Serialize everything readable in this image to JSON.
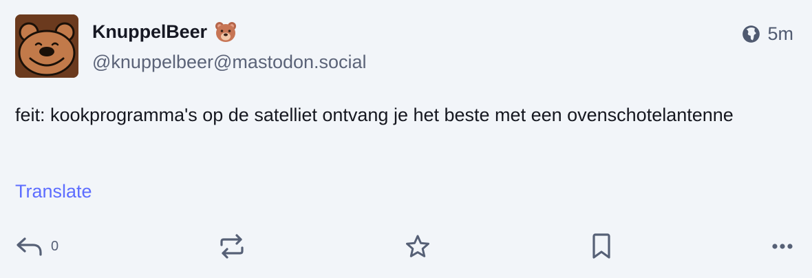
{
  "author": {
    "display_name": "KnuppelBeer",
    "emoji": "bear-face-emoji",
    "handle": "@knuppelbeer@mastodon.social",
    "avatar": "bear-avatar"
  },
  "meta": {
    "visibility_icon": "globe-icon",
    "time": "5m"
  },
  "content": {
    "text": "feit: kookprogramma's op de satelliet ontvang je het beste met een ovenschotelantenne"
  },
  "translate_label": "Translate",
  "actions": {
    "reply": {
      "icon": "reply-icon",
      "count": "0"
    },
    "boost": {
      "icon": "boost-icon"
    },
    "favourite": {
      "icon": "star-icon"
    },
    "bookmark": {
      "icon": "bookmark-icon"
    },
    "more": {
      "icon": "more-icon"
    }
  },
  "colors": {
    "background": "#f2f5f9",
    "link": "#5d6dff",
    "muted": "#566076"
  }
}
